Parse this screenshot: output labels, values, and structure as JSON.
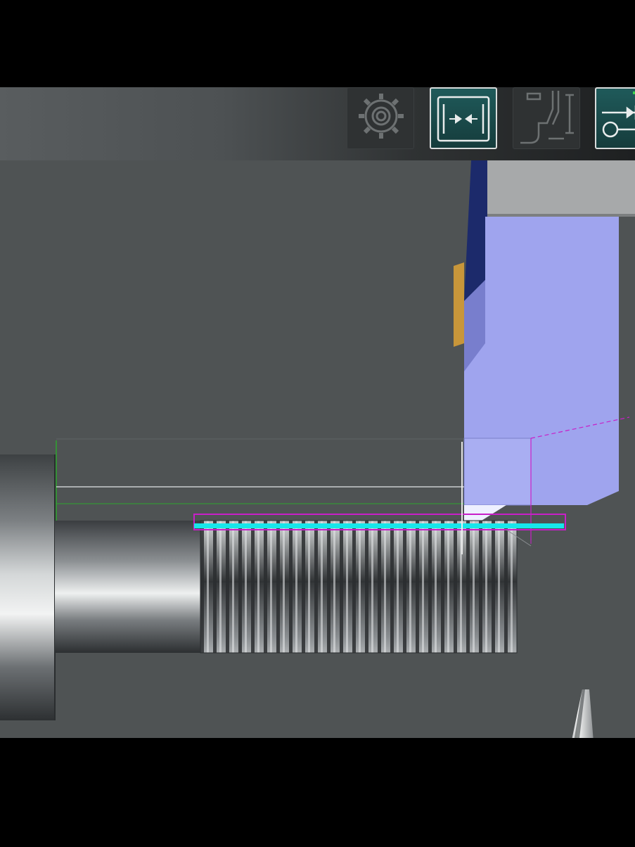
{
  "toolbar": {
    "buttons": [
      {
        "id": "settings",
        "icon": "gear-icon",
        "active": false
      },
      {
        "id": "jog",
        "icon": "jog-arrows-icon",
        "active": true
      },
      {
        "id": "tool-geometry",
        "icon": "tool-geometry-icon",
        "active": false
      },
      {
        "id": "tool-wrench",
        "icon": "wrench-icon",
        "active": true
      }
    ]
  },
  "colors": {
    "background": "#4f5354",
    "tool_holder": "#9fa4ee",
    "tool_holder_dark": "#1c2a6b",
    "insert_edge": "#c8963a",
    "toolpath_cyan": "#17e6ea",
    "toolpath_magenta": "#c81fc8",
    "boundary_green": "#2ea52e",
    "active_button": "#1f5a5a"
  }
}
